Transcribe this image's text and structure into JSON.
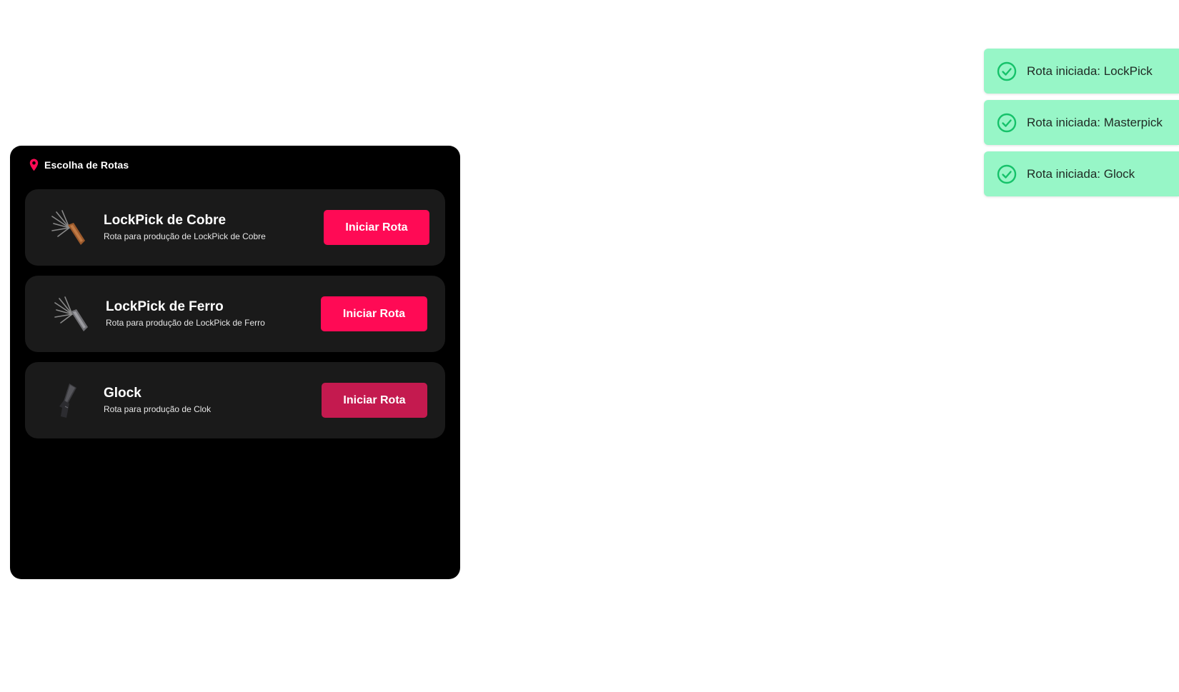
{
  "panel": {
    "title": "Escolha de Rotas",
    "pin_icon": "map-pin-icon",
    "accent_color": "#ff0a55"
  },
  "routes": [
    {
      "title": "LockPick de Cobre",
      "description": "Rota para produção de LockPick de Cobre",
      "icon": "copper-lockpick-icon",
      "button_label": "Iniciar Rota",
      "button_color": "#ff0a55"
    },
    {
      "title": "LockPick de Ferro",
      "description": "Rota para produção de LockPick de Ferro",
      "icon": "iron-lockpick-icon",
      "button_label": "Iniciar Rota",
      "button_color": "#ff0a55"
    },
    {
      "title": "Glock",
      "description": "Rota para produção de Clok",
      "icon": "pistol-icon",
      "button_label": "Iniciar Rota",
      "button_color": "#c41a4f"
    }
  ],
  "toasts": [
    {
      "message": "Rota iniciada: LockPick",
      "icon": "check-circle-icon"
    },
    {
      "message": "Rota iniciada: Masterpick",
      "icon": "check-circle-icon"
    },
    {
      "message": "Rota iniciada: Glock",
      "icon": "check-circle-icon"
    }
  ],
  "colors": {
    "panel_bg": "#000000",
    "card_bg": "#1a1a1a",
    "toast_bg": "#97f6c7",
    "success": "#16c26a"
  }
}
